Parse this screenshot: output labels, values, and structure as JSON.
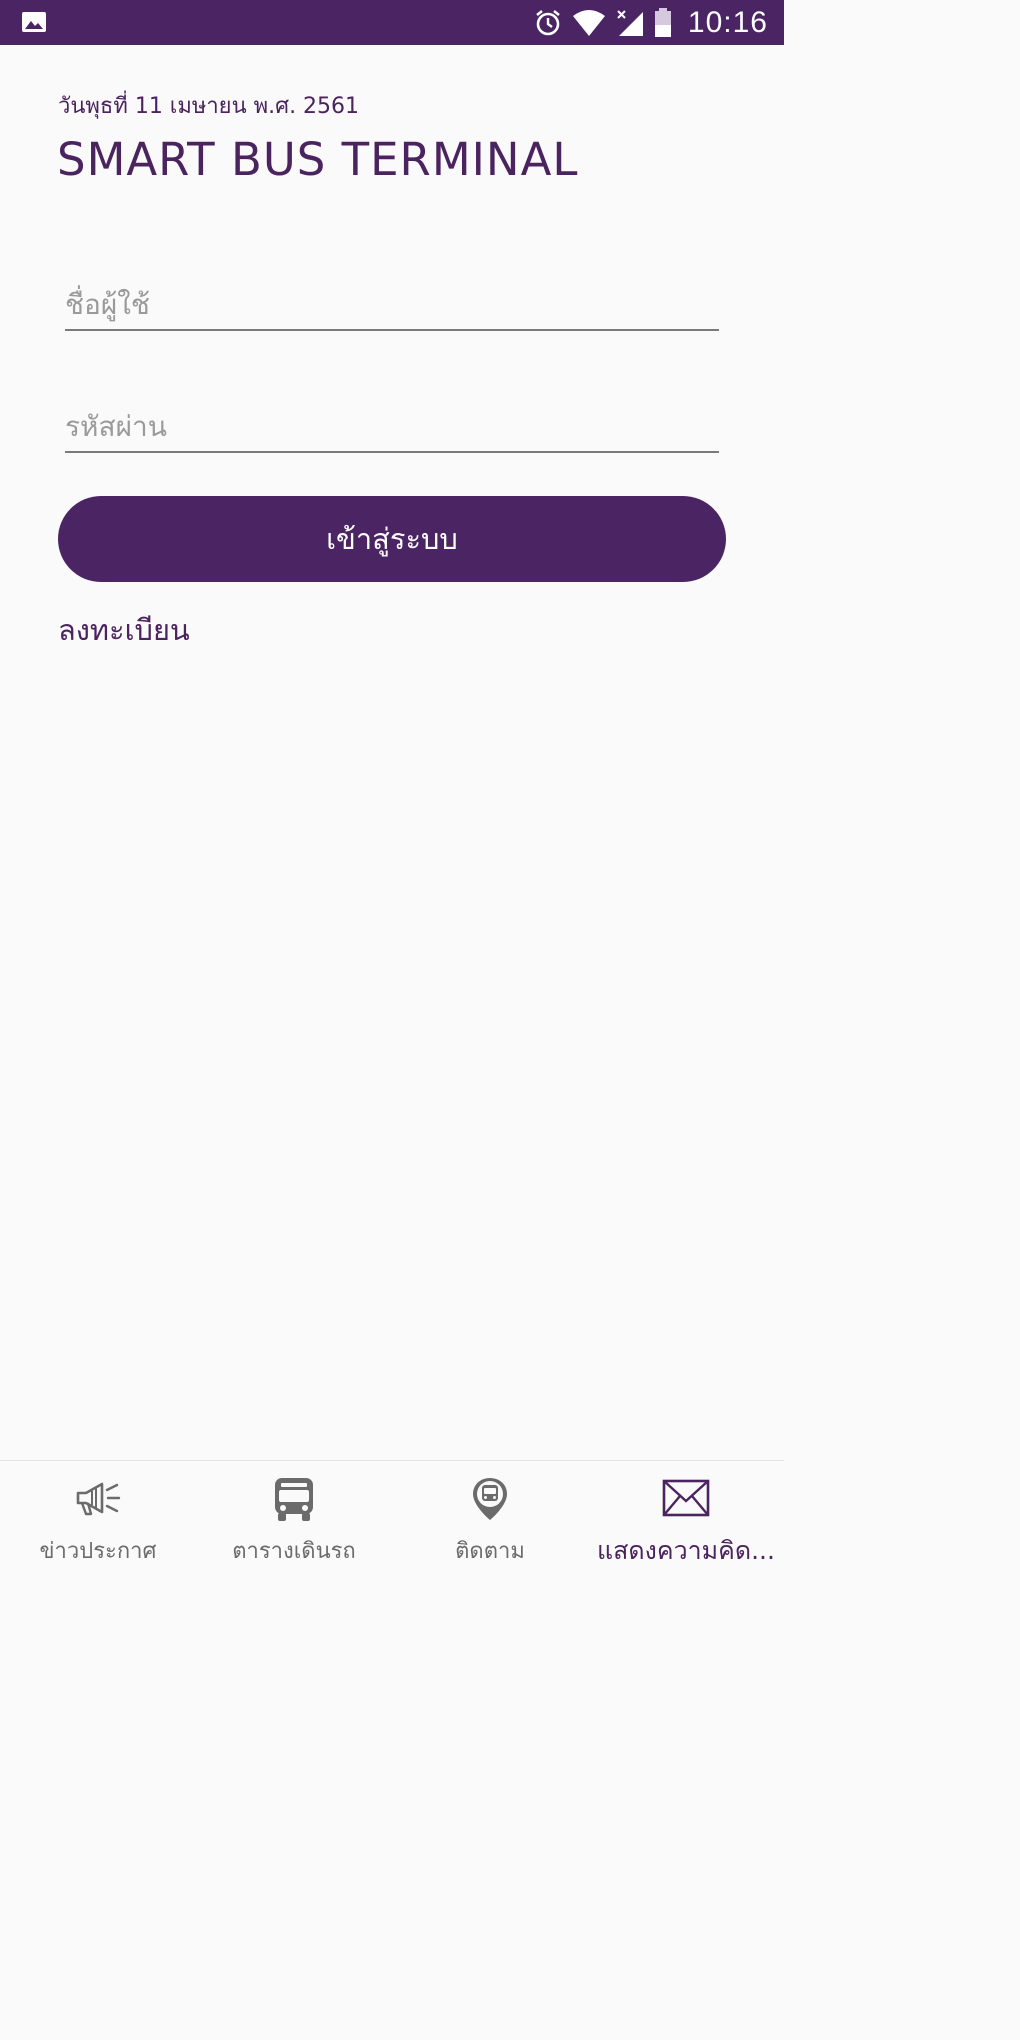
{
  "status_bar": {
    "time": "10:16",
    "icons": [
      "gallery-icon",
      "alarm-icon",
      "wifi-icon",
      "signal-icon",
      "battery-icon"
    ]
  },
  "header": {
    "date": "วันพุธที่ 11 เมษายน พ.ศ. 2561",
    "title": "SMART BUS TERMINAL"
  },
  "login": {
    "username_placeholder": "ชื่อผู้ใช้",
    "username_value": "",
    "password_placeholder": "รหัสผ่าน",
    "password_value": "",
    "submit_label": "เข้าสู่ระบบ",
    "register_label": "ลงทะเบียน"
  },
  "bottom_nav": {
    "items": [
      {
        "label": "ข่าวประกาศ",
        "icon": "megaphone-icon",
        "active": false
      },
      {
        "label": "ตารางเดินรถ",
        "icon": "bus-icon",
        "active": false
      },
      {
        "label": "ติดตาม",
        "icon": "bus-location-pin-icon",
        "active": false
      },
      {
        "label": "แสดงความคิด...",
        "icon": "mail-icon",
        "active": true
      }
    ]
  },
  "colors": {
    "primary": "#4b2463",
    "background": "#fafafa",
    "nav_inactive": "#6b6b6b"
  }
}
